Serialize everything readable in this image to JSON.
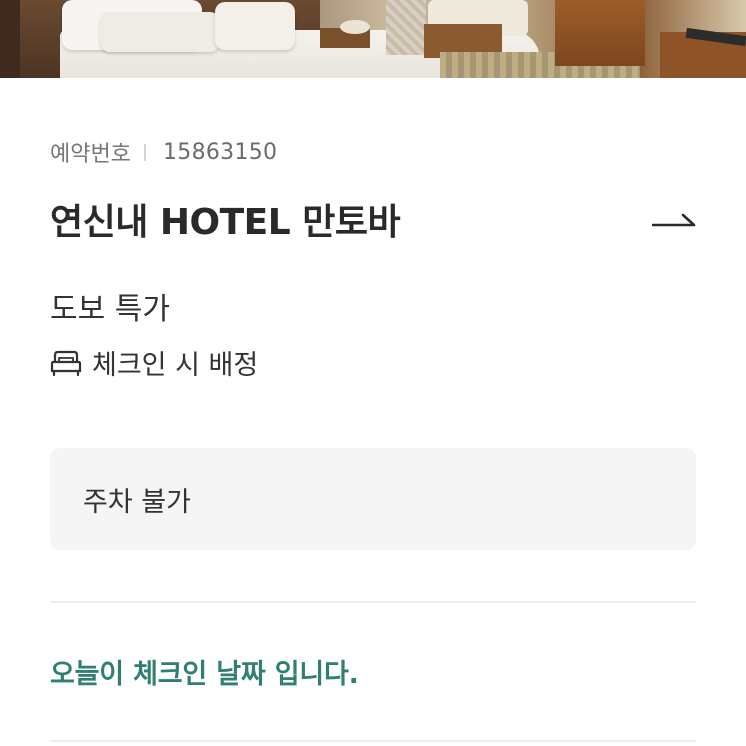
{
  "hero": {
    "image_desc_icon": "hotel-room-photo"
  },
  "reservation": {
    "label": "예약번호",
    "number": "15863150"
  },
  "hotel": {
    "name": "연신내 HOTEL 만토바",
    "link_icon": "arrow-right-icon"
  },
  "room": {
    "type": "도보 특가",
    "bed_icon": "bed-icon",
    "bed_text": "체크인 시 배정"
  },
  "notice": {
    "text": "주차 불가"
  },
  "checkin": {
    "message": "오늘이 체크인 날짜 입니다."
  },
  "colors": {
    "accent": "#2f7f73",
    "text_primary": "#2a2a2a",
    "text_secondary": "#777777",
    "notice_bg": "#f5f5f5",
    "divider": "#eeeeee"
  }
}
